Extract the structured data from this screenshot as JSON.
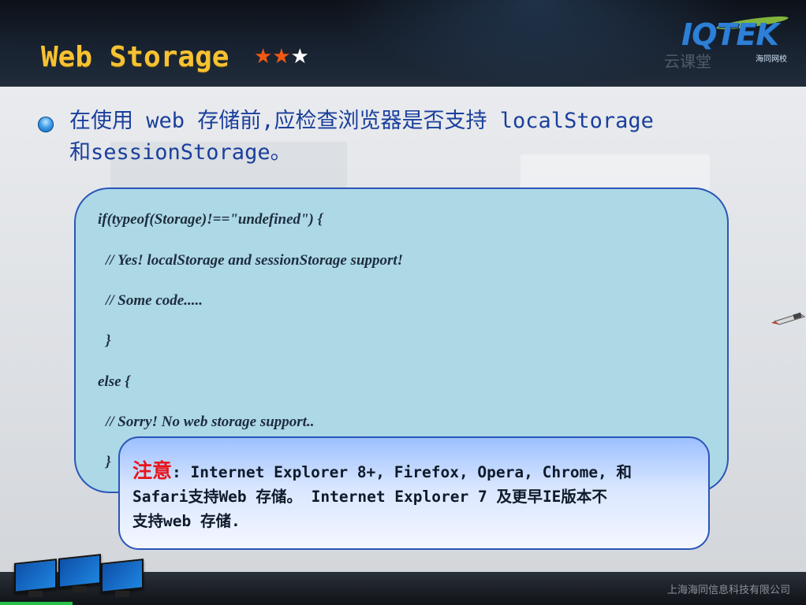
{
  "header": {
    "title": "Web Storage",
    "stars_filled": "★★",
    "stars_empty": "★",
    "logo": {
      "text": "IQTEK",
      "subtitle": "海同网校"
    },
    "watermark": "云课堂"
  },
  "intro": {
    "line1": "在使用 web 存储前,应检查浏览器是否支持 localStorage",
    "line2": "和sessionStorage。"
  },
  "code": {
    "lines": [
      "if(typeof(Storage)!==\"undefined\") {",
      "// Yes! localStorage and sessionStorage support!",
      "// Some code.....",
      "}",
      "else {",
      "// Sorry! No web storage support..",
      "}"
    ]
  },
  "note": {
    "label": "注意",
    "line1": ": Internet Explorer 8+, Firefox, Opera, Chrome, 和",
    "line2": "Safari支持Web 存储。 Internet Explorer 7 及更早IE版本不",
    "line3": "支持web 存储."
  },
  "footer": {
    "company": "上海海同信息科技有限公司"
  },
  "colors": {
    "title": "#f6c233",
    "star_on": "#f05a14",
    "intro_text": "#1a3f9c",
    "code_bg": "#add8e6",
    "border": "#2a56b8",
    "note_label": "#e8151b",
    "progress": "#27c24a"
  }
}
